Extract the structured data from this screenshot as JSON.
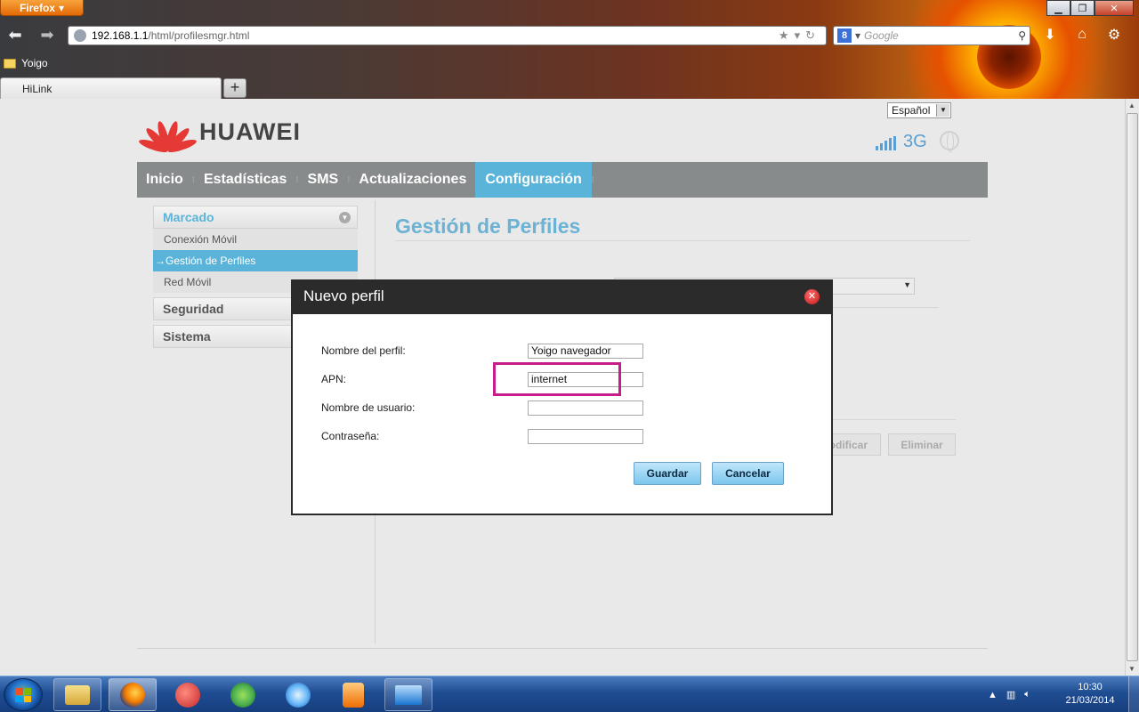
{
  "browser": {
    "menu_label": "Firefox",
    "url_host": "192.168.1.1",
    "url_path": "/html/profilesmgr.html",
    "search_placeholder": "Google",
    "bookmark_label": "Yoigo",
    "tab_label": "HiLink",
    "newtab_label": "+",
    "icons": [
      "back-arrow-icon",
      "forward-arrow-icon",
      "star-icon",
      "reload-icon",
      "download-icon",
      "home-icon",
      "addon-icon"
    ]
  },
  "header": {
    "language": "Español",
    "brand": "HUAWEI",
    "network_type": "3G"
  },
  "mainnav": {
    "items": [
      "Inicio",
      "Estadísticas",
      "SMS",
      "Actualizaciones",
      "Configuración"
    ],
    "active_index": 4
  },
  "sidebar": {
    "sections": [
      {
        "label": "Marcado",
        "open": true,
        "items": [
          "Conexión Móvil",
          "Gestión de Perfiles",
          "Red Móvil"
        ],
        "active_item": "→Gestión de Perfiles"
      },
      {
        "label": "Seguridad",
        "open": false
      },
      {
        "label": "Sistema",
        "open": false
      }
    ]
  },
  "content": {
    "title": "Gestión de Perfiles",
    "buttons": {
      "modify": "odificar",
      "delete": "Eliminar"
    }
  },
  "dialog": {
    "title": "Nuevo perfil",
    "fields": [
      {
        "label": "Nombre del perfil:",
        "value": "Yoigo navegador"
      },
      {
        "label": "APN:",
        "value": "internet"
      },
      {
        "label": "Nombre de usuario:",
        "value": ""
      },
      {
        "label": "Contraseña:",
        "value": ""
      }
    ],
    "save": "Guardar",
    "cancel": "Cancelar",
    "highlight_color": "#c51d8a"
  },
  "taskbar": {
    "time": "10:30",
    "date": "21/03/2014",
    "apps": [
      "file-explorer-icon",
      "firefox-icon",
      "ccleaner-icon",
      "spotify-icon",
      "itunes-icon",
      "media-player-icon",
      "network-control-icon"
    ]
  },
  "colors": {
    "accent": "#5ab4d9",
    "nav_bg": "#888b8c",
    "title": "#6cb2d4"
  }
}
